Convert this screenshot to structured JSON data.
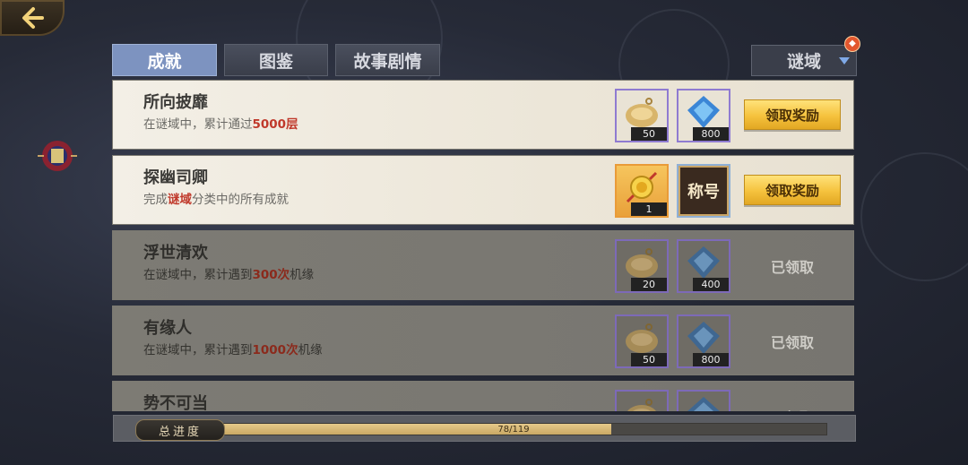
{
  "tabs": [
    {
      "label": "成就",
      "active": true
    },
    {
      "label": "图鉴",
      "active": false
    },
    {
      "label": "故事剧情",
      "active": false
    }
  ],
  "category_dropdown": {
    "selected": "谜域"
  },
  "achievements": [
    {
      "title": "所向披靡",
      "desc_parts": [
        "在谜域中，累计通过",
        "5000层",
        ""
      ],
      "rewards": [
        {
          "icon": "gold-pouch-icon",
          "count": "50"
        },
        {
          "icon": "blue-gem-icon",
          "count": "800"
        }
      ],
      "action": "领取奖励",
      "status": "open"
    },
    {
      "title": "探幽司卿",
      "desc_parts": [
        "完成",
        "谜域",
        "分类中的所有成就"
      ],
      "rewards": [
        {
          "icon": "gold-medal-icon",
          "count": "1"
        },
        {
          "icon": "title-plaque-icon",
          "label": "称号"
        }
      ],
      "action": "领取奖励",
      "status": "open"
    },
    {
      "title": "浮世清欢",
      "desc_parts": [
        "在谜域中，累计遇到",
        "300次",
        "机缘"
      ],
      "rewards": [
        {
          "icon": "gold-pouch-icon",
          "count": "20"
        },
        {
          "icon": "blue-gem-icon",
          "count": "400"
        }
      ],
      "action": "已领取",
      "status": "claimed"
    },
    {
      "title": "有缘人",
      "desc_parts": [
        "在谜域中，累计遇到",
        "1000次",
        "机缘"
      ],
      "rewards": [
        {
          "icon": "gold-pouch-icon",
          "count": "50"
        },
        {
          "icon": "blue-gem-icon",
          "count": "800"
        }
      ],
      "action": "已领取",
      "status": "claimed"
    },
    {
      "title": "势不可当",
      "desc_parts": [
        "",
        "",
        ""
      ],
      "rewards": [
        {
          "icon": "gold-pouch-icon",
          "count": ""
        },
        {
          "icon": "blue-gem-icon",
          "count": ""
        }
      ],
      "action": "已领取",
      "status": "claimed"
    }
  ],
  "progress": {
    "label": "总进度",
    "text": "78/119",
    "current": 78,
    "total": 119
  },
  "colors": {
    "highlight": "#c0392b",
    "claim_button": "#f5c23d",
    "active_tab": "#7d93c0"
  }
}
